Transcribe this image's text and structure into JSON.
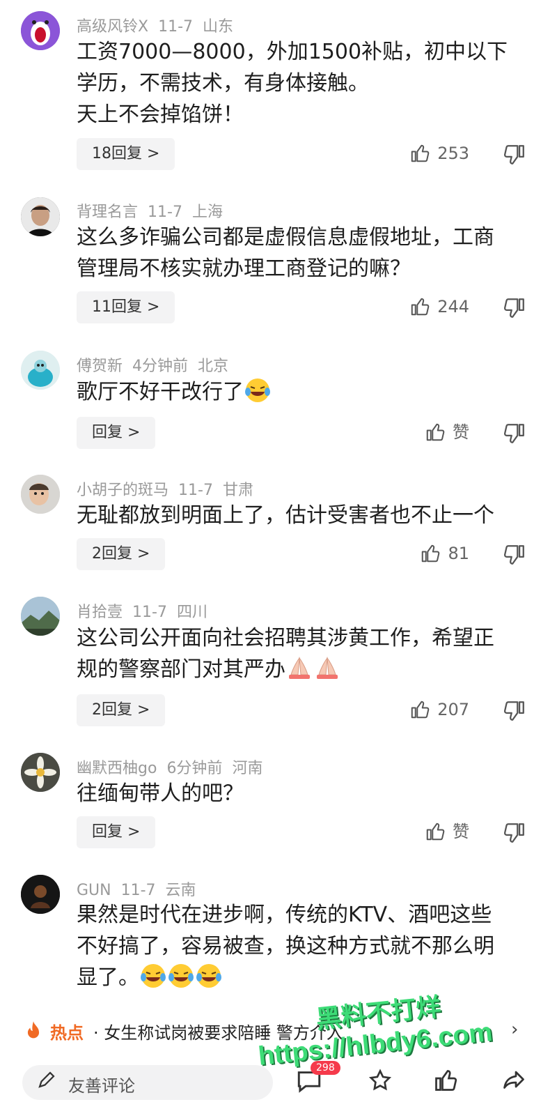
{
  "comments": [
    {
      "user": "高级风铃X",
      "date": "11-7",
      "location": "山东",
      "lines": [
        "工资7000—8000，外加1500补贴，初中以下",
        "学历，不需技术，有身体接触。",
        "天上不会掉馅饼！"
      ],
      "reply_label": "18回复 >",
      "likes": "253"
    },
    {
      "user": "背理名言",
      "date": "11-7",
      "location": "上海",
      "lines": [
        "这么多诈骗公司都是虚假信息虚假地址，工商",
        "管理局不核实就办理工商登记的嘛？"
      ],
      "reply_label": "11回复 >",
      "likes": "244"
    },
    {
      "user": "傅贺新",
      "date": "4分钟前",
      "location": "北京",
      "lines": [
        "歌厅不好干改行了"
      ],
      "reply_label": "回复 >",
      "likes": "赞"
    },
    {
      "user": "小胡子的斑马",
      "date": "11-7",
      "location": "甘肃",
      "lines": [
        "无耻都放到明面上了，估计受害者也不止一个"
      ],
      "reply_label": "2回复 >",
      "likes": "81"
    },
    {
      "user": "肖拾壹",
      "date": "11-7",
      "location": "四川",
      "lines": [
        "这公司公开面向社会招聘其涉黄工作，希望正",
        "规的警察部门对其严办"
      ],
      "reply_label": "2回复 >",
      "likes": "207"
    },
    {
      "user": "幽默西柚go",
      "date": "6分钟前",
      "location": "河南",
      "lines": [
        "往缅甸带人的吧？"
      ],
      "reply_label": "回复 >",
      "likes": "赞"
    },
    {
      "user": "GUN",
      "date": "11-7",
      "location": "云南",
      "lines": [
        "果然是时代在进步啊，传统的KTV、酒吧这些",
        "不好搞了，容易被查，换这种方式就不那么明",
        "显了。"
      ],
      "reply_label": "",
      "likes": ""
    }
  ],
  "hot": {
    "label": "热点",
    "text": "· 女生称试岗被要求陪睡 警方介入"
  },
  "watermark": {
    "line1": "黑料不打烊",
    "line2": "https://hlbdy6.com"
  },
  "bottom": {
    "placeholder": "友善评论",
    "comment_count": "298"
  },
  "colors": {
    "accent": "#f06a24",
    "badge": "#f53a4b",
    "watermark": "#3ddc77"
  }
}
